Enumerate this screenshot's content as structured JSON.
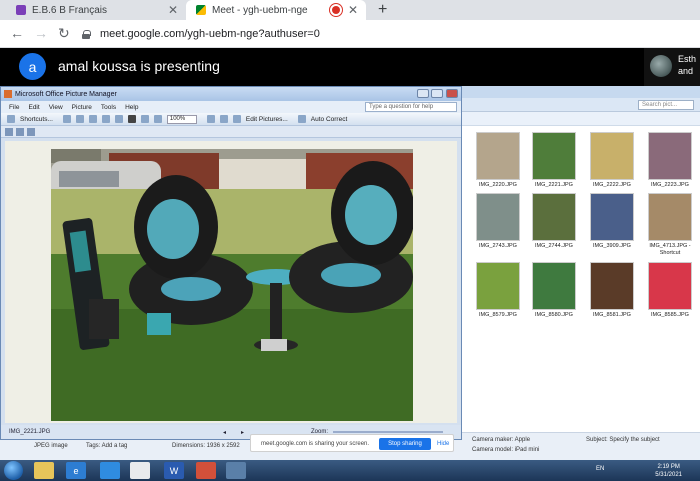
{
  "browser": {
    "tabs": [
      {
        "title": "E.B.6 B Français",
        "active": false
      },
      {
        "title": "Meet - ygh-uebm-nge",
        "active": true
      }
    ],
    "address": "meet.google.com/ygh-uebm-nge?authuser=0"
  },
  "meet": {
    "presenter_initial": "a",
    "presenting_text": "amal koussa is presenting",
    "participant_name": "Esth\nand"
  },
  "picture_manager": {
    "title": "Microsoft Office Picture Manager",
    "menu": [
      "File",
      "Edit",
      "View",
      "Picture",
      "Tools",
      "Help"
    ],
    "help_placeholder": "Type a question for help",
    "toolbar": {
      "shortcuts": "Shortcuts...",
      "zoom": "100%",
      "edit_pictures": "Edit Pictures...",
      "auto_correct": "Auto Correct"
    },
    "filename": "IMG_2221.JPG",
    "status_zoom_label": "Zoom:"
  },
  "explorer": {
    "search_placeholder": "Search pict...",
    "thumbnails": [
      {
        "name": "IMG_2220.JPG",
        "color": "#b4a58c"
      },
      {
        "name": "IMG_2221.JPG",
        "color": "#4f7d3a"
      },
      {
        "name": "IMG_2222.JPG",
        "color": "#c8b06a"
      },
      {
        "name": "IMG_2223.JPG",
        "color": "#8a6a7a"
      },
      {
        "name": "IMG_2743.JPG",
        "color": "#7f8f8a"
      },
      {
        "name": "IMG_2744.JPG",
        "color": "#5b6f3d"
      },
      {
        "name": "IMG_3909.JPG",
        "color": "#4a5f8a"
      },
      {
        "name": "IMG_4713.JPG - Shortcut",
        "color": "#a58a68"
      },
      {
        "name": "IMG_8579.JPG",
        "color": "#7aa13e"
      },
      {
        "name": "IMG_8580.JPG",
        "color": "#3f7a3f"
      },
      {
        "name": "IMG_8581.JPG",
        "color": "#5a3b28"
      },
      {
        "name": "IMG_8585.JPG",
        "color": "#d8374a"
      }
    ],
    "details": {
      "type": "JPEG image",
      "tags": "Tags: Add a tag",
      "dimensions": "Dimensions: 1936 x 2592",
      "camera_maker": "Camera maker:  Apple",
      "camera_model": "Camera model:  iPad mini",
      "subject": "Subject:  Specify the subject"
    }
  },
  "share_notice": {
    "text": "meet.google.com is sharing your screen.",
    "stop": "Stop sharing",
    "hide": "Hide"
  },
  "taskbar": {
    "lang": "EN",
    "time": "2:19 PM",
    "date": "5/31/2021"
  }
}
